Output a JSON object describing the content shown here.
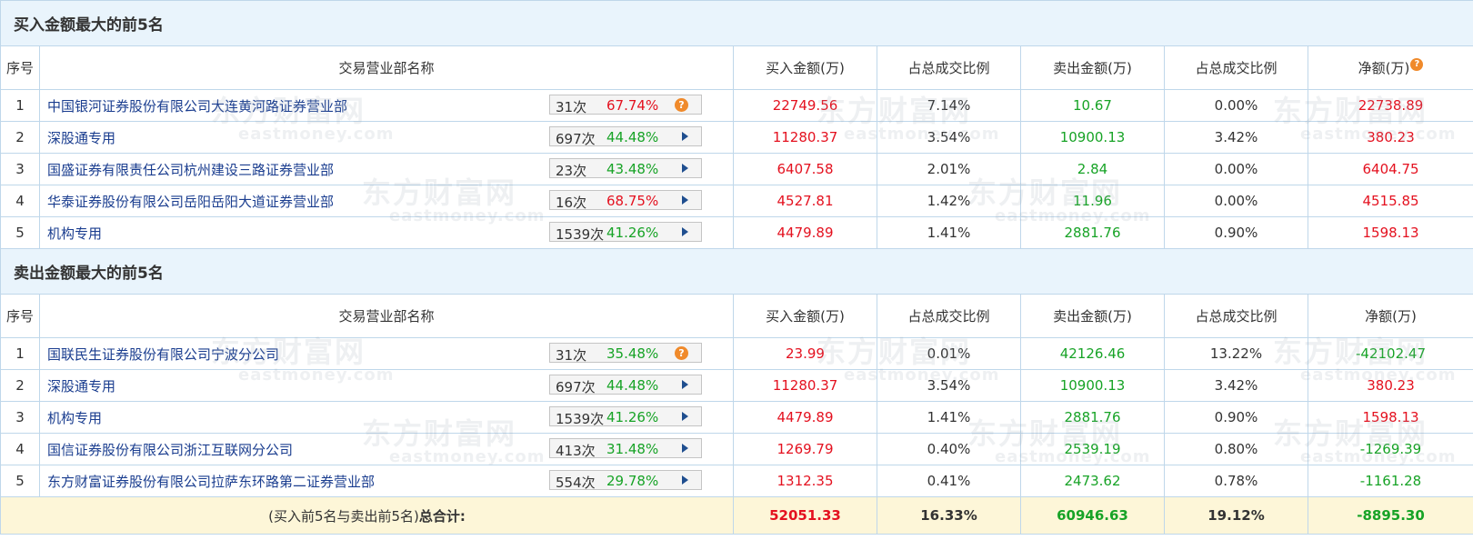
{
  "sections": [
    {
      "title": "买入金额最大的前5名",
      "headers": {
        "seq": "序号",
        "name": "交易营业部名称",
        "buy": "买入金额(万)",
        "buy_pct": "占总成交比例",
        "sell": "卖出金额(万)",
        "sell_pct": "占总成交比例",
        "net": "净额(万)",
        "net_help_icon": "question-icon"
      },
      "rows": [
        {
          "seq": "1",
          "name": "中国银河证券股份有限公司大连黄河路证券营业部",
          "count": "31次",
          "rate": "67.74%",
          "rate_color": "red",
          "action_icon": "question-icon",
          "buy": "22749.56",
          "buy_pct": "7.14%",
          "sell": "10.67",
          "sell_pct": "0.00%",
          "net": "22738.89",
          "net_sign": "pos"
        },
        {
          "seq": "2",
          "name": "深股通专用",
          "count": "697次",
          "rate": "44.48%",
          "rate_color": "green",
          "action_icon": "arrow-right-icon",
          "buy": "11280.37",
          "buy_pct": "3.54%",
          "sell": "10900.13",
          "sell_pct": "3.42%",
          "net": "380.23",
          "net_sign": "pos"
        },
        {
          "seq": "3",
          "name": "国盛证券有限责任公司杭州建设三路证券营业部",
          "count": "23次",
          "rate": "43.48%",
          "rate_color": "green",
          "action_icon": "arrow-right-icon",
          "buy": "6407.58",
          "buy_pct": "2.01%",
          "sell": "2.84",
          "sell_pct": "0.00%",
          "net": "6404.75",
          "net_sign": "pos"
        },
        {
          "seq": "4",
          "name": "华泰证券股份有限公司岳阳岳阳大道证券营业部",
          "count": "16次",
          "rate": "68.75%",
          "rate_color": "red",
          "action_icon": "arrow-right-icon",
          "buy": "4527.81",
          "buy_pct": "1.42%",
          "sell": "11.96",
          "sell_pct": "0.00%",
          "net": "4515.85",
          "net_sign": "pos"
        },
        {
          "seq": "5",
          "name": "机构专用",
          "count": "1539次",
          "rate": "41.26%",
          "rate_color": "green",
          "action_icon": "arrow-right-icon",
          "buy": "4479.89",
          "buy_pct": "1.41%",
          "sell": "2881.76",
          "sell_pct": "0.90%",
          "net": "1598.13",
          "net_sign": "pos"
        }
      ]
    },
    {
      "title": "卖出金额最大的前5名",
      "headers": {
        "seq": "序号",
        "name": "交易营业部名称",
        "buy": "买入金额(万)",
        "buy_pct": "占总成交比例",
        "sell": "卖出金额(万)",
        "sell_pct": "占总成交比例",
        "net": "净额(万)"
      },
      "rows": [
        {
          "seq": "1",
          "name": "国联民生证券股份有限公司宁波分公司",
          "count": "31次",
          "rate": "35.48%",
          "rate_color": "green",
          "action_icon": "question-icon",
          "buy": "23.99",
          "buy_pct": "0.01%",
          "sell": "42126.46",
          "sell_pct": "13.22%",
          "net": "-42102.47",
          "net_sign": "neg"
        },
        {
          "seq": "2",
          "name": "深股通专用",
          "count": "697次",
          "rate": "44.48%",
          "rate_color": "green",
          "action_icon": "arrow-right-icon",
          "buy": "11280.37",
          "buy_pct": "3.54%",
          "sell": "10900.13",
          "sell_pct": "3.42%",
          "net": "380.23",
          "net_sign": "pos"
        },
        {
          "seq": "3",
          "name": "机构专用",
          "count": "1539次",
          "rate": "41.26%",
          "rate_color": "green",
          "action_icon": "arrow-right-icon",
          "buy": "4479.89",
          "buy_pct": "1.41%",
          "sell": "2881.76",
          "sell_pct": "0.90%",
          "net": "1598.13",
          "net_sign": "pos"
        },
        {
          "seq": "4",
          "name": "国信证券股份有限公司浙江互联网分公司",
          "count": "413次",
          "rate": "31.48%",
          "rate_color": "green",
          "action_icon": "arrow-right-icon",
          "buy": "1269.79",
          "buy_pct": "0.40%",
          "sell": "2539.19",
          "sell_pct": "0.80%",
          "net": "-1269.39",
          "net_sign": "neg"
        },
        {
          "seq": "5",
          "name": "东方财富证券股份有限公司拉萨东环路第二证券营业部",
          "count": "554次",
          "rate": "29.78%",
          "rate_color": "green",
          "action_icon": "arrow-right-icon",
          "buy": "1312.35",
          "buy_pct": "0.41%",
          "sell": "2473.62",
          "sell_pct": "0.78%",
          "net": "-1161.28",
          "net_sign": "neg"
        }
      ]
    }
  ],
  "total": {
    "label_prefix": "(买入前5名与卖出前5名)",
    "label_bold": "总合计:",
    "buy": "52051.33",
    "buy_pct": "16.33%",
    "sell": "60946.63",
    "sell_pct": "19.12%",
    "net": "-8895.30"
  },
  "watermark": {
    "brand": "东方财富网",
    "domain": "eastmoney.com"
  },
  "colors": {
    "positive": "#e4111f",
    "negative": "#17a326",
    "title_bg": "#e9f4fc",
    "border": "#bfd7ea",
    "total_bg": "#fdf6d8",
    "name_text": "#1a3d8f",
    "help_icon": "#f08a2b"
  }
}
